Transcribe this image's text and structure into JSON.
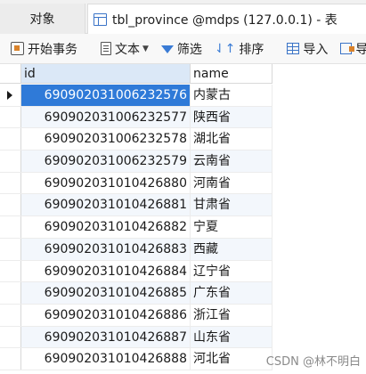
{
  "tabs": [
    {
      "label": "对象"
    },
    {
      "label": "tbl_province @mdps (127.0.0.1) - 表"
    }
  ],
  "toolbar": {
    "begin_transaction": "开始事务",
    "text": "文本",
    "filter": "筛选",
    "sort": "排序",
    "import": "导入",
    "export": "导"
  },
  "columns": {
    "id": "id",
    "name": "name"
  },
  "rows": [
    {
      "id": "690902031006232576",
      "name": "内蒙古"
    },
    {
      "id": "690902031006232577",
      "name": "陕西省"
    },
    {
      "id": "690902031006232578",
      "name": "湖北省"
    },
    {
      "id": "690902031006232579",
      "name": "云南省"
    },
    {
      "id": "690902031010426880",
      "name": "河南省"
    },
    {
      "id": "690902031010426881",
      "name": "甘肃省"
    },
    {
      "id": "690902031010426882",
      "name": "宁夏"
    },
    {
      "id": "690902031010426883",
      "name": "西藏"
    },
    {
      "id": "690902031010426884",
      "name": "辽宁省"
    },
    {
      "id": "690902031010426885",
      "name": "广东省"
    },
    {
      "id": "690902031010426886",
      "name": "浙江省"
    },
    {
      "id": "690902031010426887",
      "name": "山东省"
    },
    {
      "id": "690902031010426888",
      "name": "河北省"
    }
  ],
  "watermark": "CSDN @林不明白",
  "colors": {
    "selection": "#2f7ad8",
    "header_highlight": "#dbe8f7",
    "accent": "#3a7bd5"
  }
}
